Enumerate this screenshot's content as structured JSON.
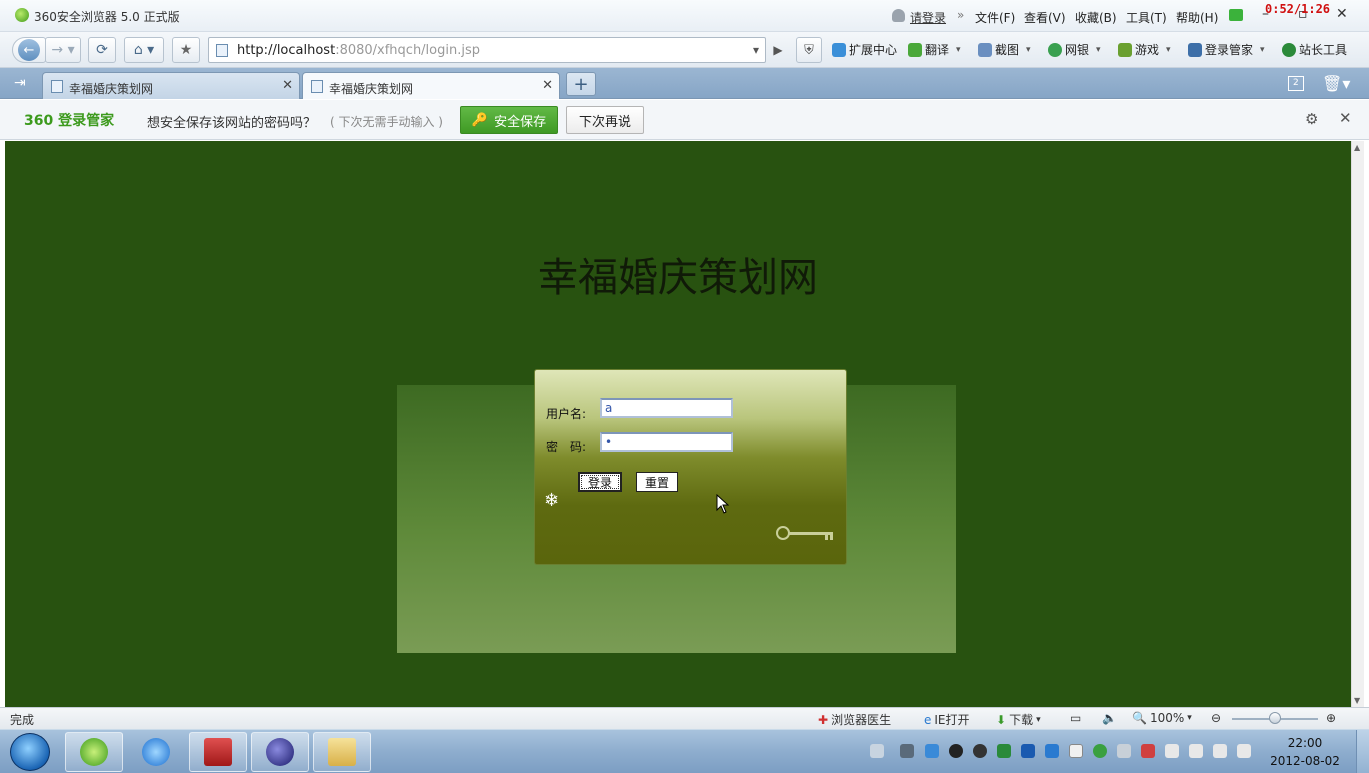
{
  "browser": {
    "title": "360安全浏览器 5.0 正式版",
    "login_link": "请登录",
    "menus": [
      "文件(F)",
      "查看(V)",
      "收藏(B)",
      "工具(T)",
      "帮助(H)"
    ],
    "timer": "0:52/1:26"
  },
  "nav": {
    "url_host": "http://localhost",
    "url_rest": ":8080/xfhqch/login.jsp",
    "tools": [
      "扩展中心",
      "翻译",
      "截图",
      "网银",
      "游戏",
      "登录管家",
      "站长工具"
    ]
  },
  "tabs": [
    {
      "label": "幸福婚庆策划网",
      "active": false
    },
    {
      "label": "幸福婚庆策划网",
      "active": true
    }
  ],
  "tab_counter": "2",
  "password_bar": {
    "brand": "360 登录管家",
    "question": "想安全保存该网站的密码吗？",
    "hint": "( 下次无需手动输入 )",
    "save_label": "安全保存",
    "later_label": "下次再说"
  },
  "page": {
    "heading": "幸福婚庆策划网",
    "form": {
      "username_label": "用户名:",
      "username_value": "a",
      "password_label": "密　码:",
      "password_value": "•",
      "login_label": "登录",
      "reset_label": "重置"
    }
  },
  "status": {
    "text": "完成",
    "doctor": "浏览器医生",
    "ie_open": "IE打开",
    "download": "下载",
    "zoom": "100%"
  },
  "clock": {
    "time": "22:00",
    "date": "2012-08-02"
  },
  "colors": {
    "page_bg": "#285210",
    "brand_green": "#3c9a1d",
    "timer_red": "#d01010"
  }
}
